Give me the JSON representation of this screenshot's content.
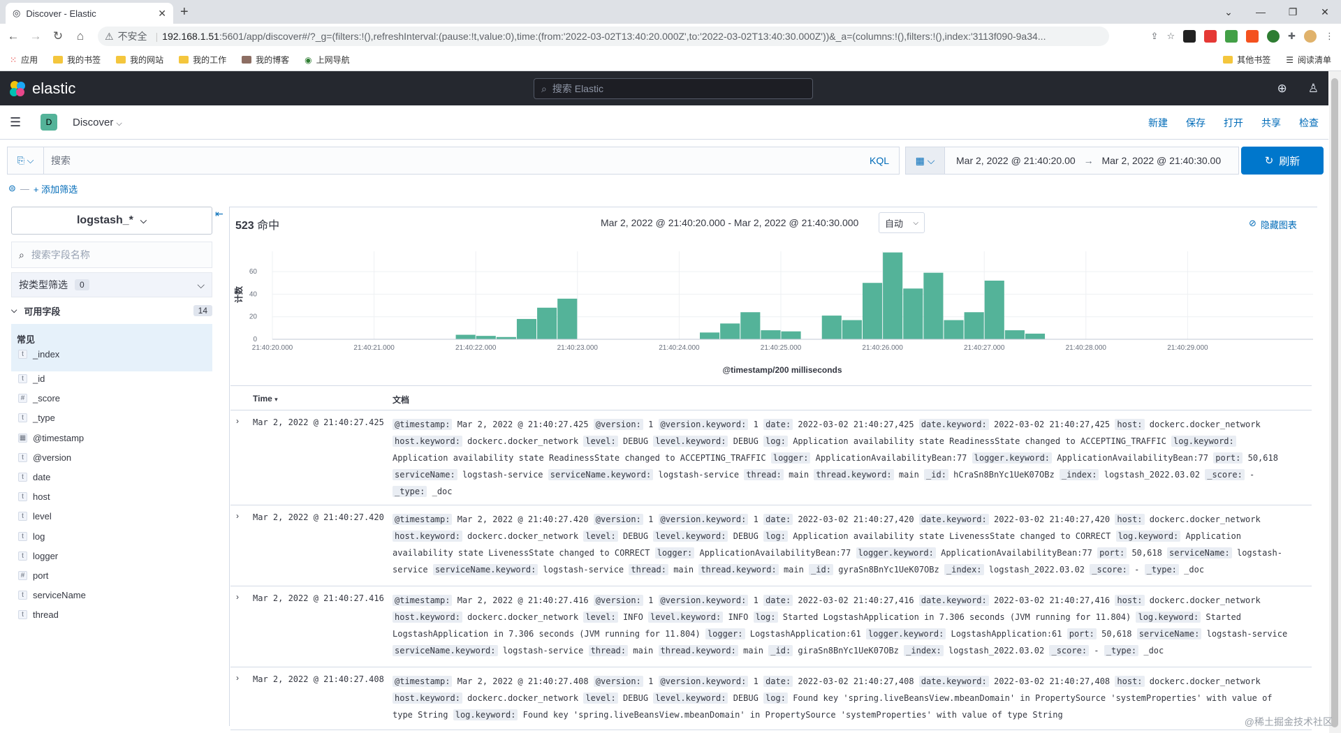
{
  "browser": {
    "tab_title": "Discover - Elastic",
    "new_tab": "+",
    "window_controls": [
      "⌄",
      "—",
      "❐",
      "✕"
    ],
    "security_label": "不安全",
    "url_host": "192.168.1.51",
    "url_rest": ":5601/app/discover#/?_g=(filters:!(),refreshInterval:(pause:!t,value:0),time:(from:'2022-03-02T13:40:20.000Z',to:'2022-03-02T13:40:30.000Z'))&_a=(columns:!(),filters:!(),index:'3113f090-9a34...",
    "bookmarks": [
      "应用",
      "我的书签",
      "我的网站",
      "我的工作",
      "我的博客",
      "上网导航"
    ],
    "bookmarks_right": [
      "其他书签",
      "阅读清单"
    ]
  },
  "kibana": {
    "logo_text": "elastic",
    "search_placeholder": "搜索 Elastic",
    "app_badge": "D",
    "breadcrumb": "Discover",
    "top_nav": [
      "新建",
      "保存",
      "打开",
      "共享",
      "检查"
    ],
    "query_placeholder": "搜索",
    "kql_label": "KQL",
    "date_start": "Mar 2, 2022 @ 21:40:20.00",
    "date_arrow": "→",
    "date_end": "Mar 2, 2022 @ 21:40:30.00",
    "refresh_label": "刷新",
    "add_filter": "+ 添加筛选"
  },
  "sidebar": {
    "index_pattern": "logstash_*",
    "field_search_placeholder": "搜索字段名称",
    "filter_by_type": "按类型筛选",
    "filter_count": "0",
    "available_label": "可用字段",
    "available_count": "14",
    "common_label": "常见",
    "common_fields": [
      {
        "type": "t",
        "name": "_index"
      }
    ],
    "fields": [
      {
        "type": "t",
        "name": "_id"
      },
      {
        "type": "#",
        "name": "_score"
      },
      {
        "type": "t",
        "name": "_type"
      },
      {
        "type": "▦",
        "name": "@timestamp"
      },
      {
        "type": "t",
        "name": "@version"
      },
      {
        "type": "t",
        "name": "date"
      },
      {
        "type": "t",
        "name": "host"
      },
      {
        "type": "t",
        "name": "level"
      },
      {
        "type": "t",
        "name": "log"
      },
      {
        "type": "t",
        "name": "logger"
      },
      {
        "type": "#",
        "name": "port"
      },
      {
        "type": "t",
        "name": "serviceName"
      },
      {
        "type": "t",
        "name": "thread"
      }
    ]
  },
  "histogram": {
    "hits_count": "523",
    "hits_label": "命中",
    "range_label": "Mar 2, 2022 @ 21:40:20.000 - Mar 2, 2022 @ 21:40:30.000",
    "interval": "自动",
    "hide_chart": "隐藏图表"
  },
  "chart_data": {
    "type": "bar",
    "xlabel": "@timestamp/200 milliseconds",
    "ylabel": "计数",
    "ylim": [
      0,
      78
    ],
    "yticks": [
      0,
      20,
      40,
      60
    ],
    "xticks": [
      "21:40:20.000",
      "21:40:21.000",
      "21:40:22.000",
      "21:40:23.000",
      "21:40:24.000",
      "21:40:25.000",
      "21:40:26.000",
      "21:40:27.000",
      "21:40:28.000",
      "21:40:29.000"
    ],
    "bar_color": "#54b399",
    "grid": true,
    "x_start": "21:40:20.000",
    "x_step": "200 milliseconds",
    "values": [
      0,
      0,
      0,
      0,
      0,
      0,
      0,
      0,
      0,
      4,
      3,
      2,
      18,
      28,
      36,
      0,
      0,
      0,
      0,
      0,
      0,
      6,
      14,
      24,
      8,
      7,
      0,
      21,
      17,
      50,
      77,
      45,
      59,
      17,
      24,
      52,
      8,
      5,
      0,
      0,
      0,
      0,
      0,
      0,
      0,
      0,
      0,
      0,
      0,
      0
    ]
  },
  "table": {
    "col_time": "Time",
    "col_doc": "文档",
    "rows": [
      {
        "time": "Mar 2, 2022 @ 21:40:27.425",
        "fields": [
          [
            "@timestamp:",
            "Mar 2, 2022 @ 21:40:27.425"
          ],
          [
            "@version:",
            "1"
          ],
          [
            "@version.keyword:",
            "1"
          ],
          [
            "date:",
            "2022-03-02 21:40:27,425"
          ],
          [
            "date.keyword:",
            "2022-03-02 21:40:27,425"
          ],
          [
            "host:",
            "dockerc.docker_network"
          ],
          [
            "host.keyword:",
            "dockerc.docker_network"
          ],
          [
            "level:",
            "DEBUG"
          ],
          [
            "level.keyword:",
            "DEBUG"
          ],
          [
            "log:",
            "Application availability state ReadinessState changed to ACCEPTING_TRAFFIC"
          ],
          [
            "log.keyword:",
            "Application availability state ReadinessState changed to ACCEPTING_TRAFFIC"
          ],
          [
            "logger:",
            "ApplicationAvailabilityBean:77"
          ],
          [
            "logger.keyword:",
            "ApplicationAvailabilityBean:77"
          ],
          [
            "port:",
            "50,618"
          ],
          [
            "serviceName:",
            "logstash-service"
          ],
          [
            "serviceName.keyword:",
            "logstash-service"
          ],
          [
            "thread:",
            "main"
          ],
          [
            "thread.keyword:",
            "main"
          ],
          [
            "_id:",
            "hCraSn8BnYc1UeK07OBz"
          ],
          [
            "_index:",
            "logstash_2022.03.02"
          ],
          [
            "_score:",
            "-"
          ],
          [
            "_type:",
            "_doc"
          ]
        ]
      },
      {
        "time": "Mar 2, 2022 @ 21:40:27.420",
        "fields": [
          [
            "@timestamp:",
            "Mar 2, 2022 @ 21:40:27.420"
          ],
          [
            "@version:",
            "1"
          ],
          [
            "@version.keyword:",
            "1"
          ],
          [
            "date:",
            "2022-03-02 21:40:27,420"
          ],
          [
            "date.keyword:",
            "2022-03-02 21:40:27,420"
          ],
          [
            "host:",
            "dockerc.docker_network"
          ],
          [
            "host.keyword:",
            "dockerc.docker_network"
          ],
          [
            "level:",
            "DEBUG"
          ],
          [
            "level.keyword:",
            "DEBUG"
          ],
          [
            "log:",
            "Application availability state LivenessState changed to CORRECT"
          ],
          [
            "log.keyword:",
            "Application availability state LivenessState changed to CORRECT"
          ],
          [
            "logger:",
            "ApplicationAvailabilityBean:77"
          ],
          [
            "logger.keyword:",
            "ApplicationAvailabilityBean:77"
          ],
          [
            "port:",
            "50,618"
          ],
          [
            "serviceName:",
            "logstash-service"
          ],
          [
            "serviceName.keyword:",
            "logstash-service"
          ],
          [
            "thread:",
            "main"
          ],
          [
            "thread.keyword:",
            "main"
          ],
          [
            "_id:",
            "gyraSn8BnYc1UeK07OBz"
          ],
          [
            "_index:",
            "logstash_2022.03.02"
          ],
          [
            "_score:",
            "-"
          ],
          [
            "_type:",
            "_doc"
          ]
        ]
      },
      {
        "time": "Mar 2, 2022 @ 21:40:27.416",
        "fields": [
          [
            "@timestamp:",
            "Mar 2, 2022 @ 21:40:27.416"
          ],
          [
            "@version:",
            "1"
          ],
          [
            "@version.keyword:",
            "1"
          ],
          [
            "date:",
            "2022-03-02 21:40:27,416"
          ],
          [
            "date.keyword:",
            "2022-03-02 21:40:27,416"
          ],
          [
            "host:",
            "dockerc.docker_network"
          ],
          [
            "host.keyword:",
            "dockerc.docker_network"
          ],
          [
            "level:",
            "INFO"
          ],
          [
            "level.keyword:",
            "INFO"
          ],
          [
            "log:",
            "Started LogstashApplication in 7.306 seconds (JVM running for 11.804)"
          ],
          [
            "log.keyword:",
            "Started LogstashApplication in 7.306 seconds (JVM running for 11.804)"
          ],
          [
            "logger:",
            "LogstashApplication:61"
          ],
          [
            "logger.keyword:",
            "LogstashApplication:61"
          ],
          [
            "port:",
            "50,618"
          ],
          [
            "serviceName:",
            "logstash-service"
          ],
          [
            "serviceName.keyword:",
            "logstash-service"
          ],
          [
            "thread:",
            "main"
          ],
          [
            "thread.keyword:",
            "main"
          ],
          [
            "_id:",
            "giraSn8BnYc1UeK07OBz"
          ],
          [
            "_index:",
            "logstash_2022.03.02"
          ],
          [
            "_score:",
            "-"
          ],
          [
            "_type:",
            "_doc"
          ]
        ]
      },
      {
        "time": "Mar 2, 2022 @ 21:40:27.408",
        "fields": [
          [
            "@timestamp:",
            "Mar 2, 2022 @ 21:40:27.408"
          ],
          [
            "@version:",
            "1"
          ],
          [
            "@version.keyword:",
            "1"
          ],
          [
            "date:",
            "2022-03-02 21:40:27,408"
          ],
          [
            "date.keyword:",
            "2022-03-02 21:40:27,408"
          ],
          [
            "host:",
            "dockerc.docker_network"
          ],
          [
            "host.keyword:",
            "dockerc.docker_network"
          ],
          [
            "level:",
            "DEBUG"
          ],
          [
            "level.keyword:",
            "DEBUG"
          ],
          [
            "log:",
            "Found key 'spring.liveBeansView.mbeanDomain' in PropertySource 'systemProperties' with value of type String"
          ],
          [
            "log.keyword:",
            "Found key 'spring.liveBeansView.mbeanDomain' in PropertySource 'systemProperties' with value of type String"
          ]
        ]
      }
    ]
  },
  "watermark": "@稀土掘金技术社区"
}
